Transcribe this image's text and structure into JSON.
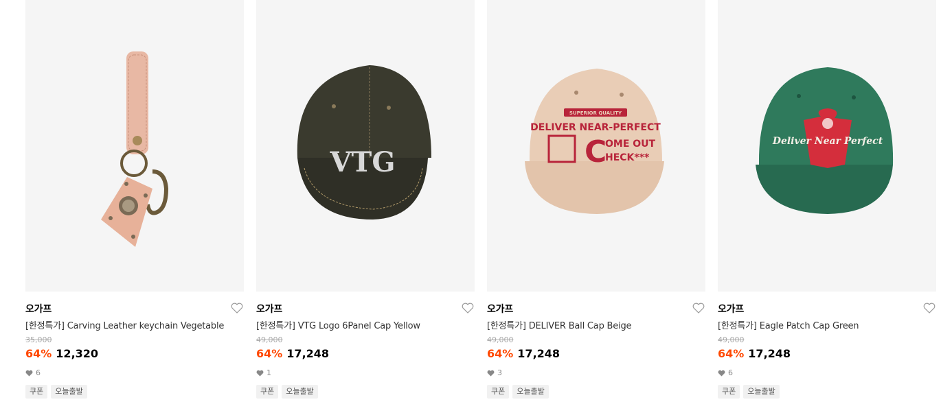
{
  "products": [
    {
      "brand": "오가프",
      "title": "[한정특가] Carving Leather keychain Vegetable",
      "original_price": "35,000",
      "discount": "64%",
      "price": "12,320",
      "likes": "6",
      "tags": [
        "쿠폰",
        "오늘출발"
      ],
      "image_icon": "leather-keychain-image"
    },
    {
      "brand": "오가프",
      "title": "[한정특가] VTG Logo 6Panel Cap Yellow",
      "original_price": "49,000",
      "discount": "64%",
      "price": "17,248",
      "likes": "1",
      "tags": [
        "쿠폰",
        "오늘출발"
      ],
      "image_icon": "vtg-cap-image",
      "cap_text": "VTG"
    },
    {
      "brand": "오가프",
      "title": "[한정특가] DELIVER Ball Cap Beige",
      "original_price": "49,000",
      "discount": "64%",
      "price": "17,248",
      "likes": "3",
      "tags": [
        "쿠폰",
        "오늘출발"
      ],
      "image_icon": "deliver-cap-image",
      "cap_text_top": "SUPERIOR QUALITY",
      "cap_text_main": "DELIVER NEAR-PERFECT",
      "cap_text_c1": "OME OUT",
      "cap_text_c2": "HECK***"
    },
    {
      "brand": "오가프",
      "title": "[한정특가] Eagle Patch Cap Green",
      "original_price": "49,000",
      "discount": "64%",
      "price": "17,248",
      "likes": "6",
      "tags": [
        "쿠폰",
        "오늘출발"
      ],
      "image_icon": "eagle-cap-image",
      "cap_text": "Deliver Near Perfect"
    }
  ],
  "colors": {
    "discount": "#ff4800",
    "image_bg": "#f5f5f5",
    "tag_bg": "#f1f1f1"
  }
}
